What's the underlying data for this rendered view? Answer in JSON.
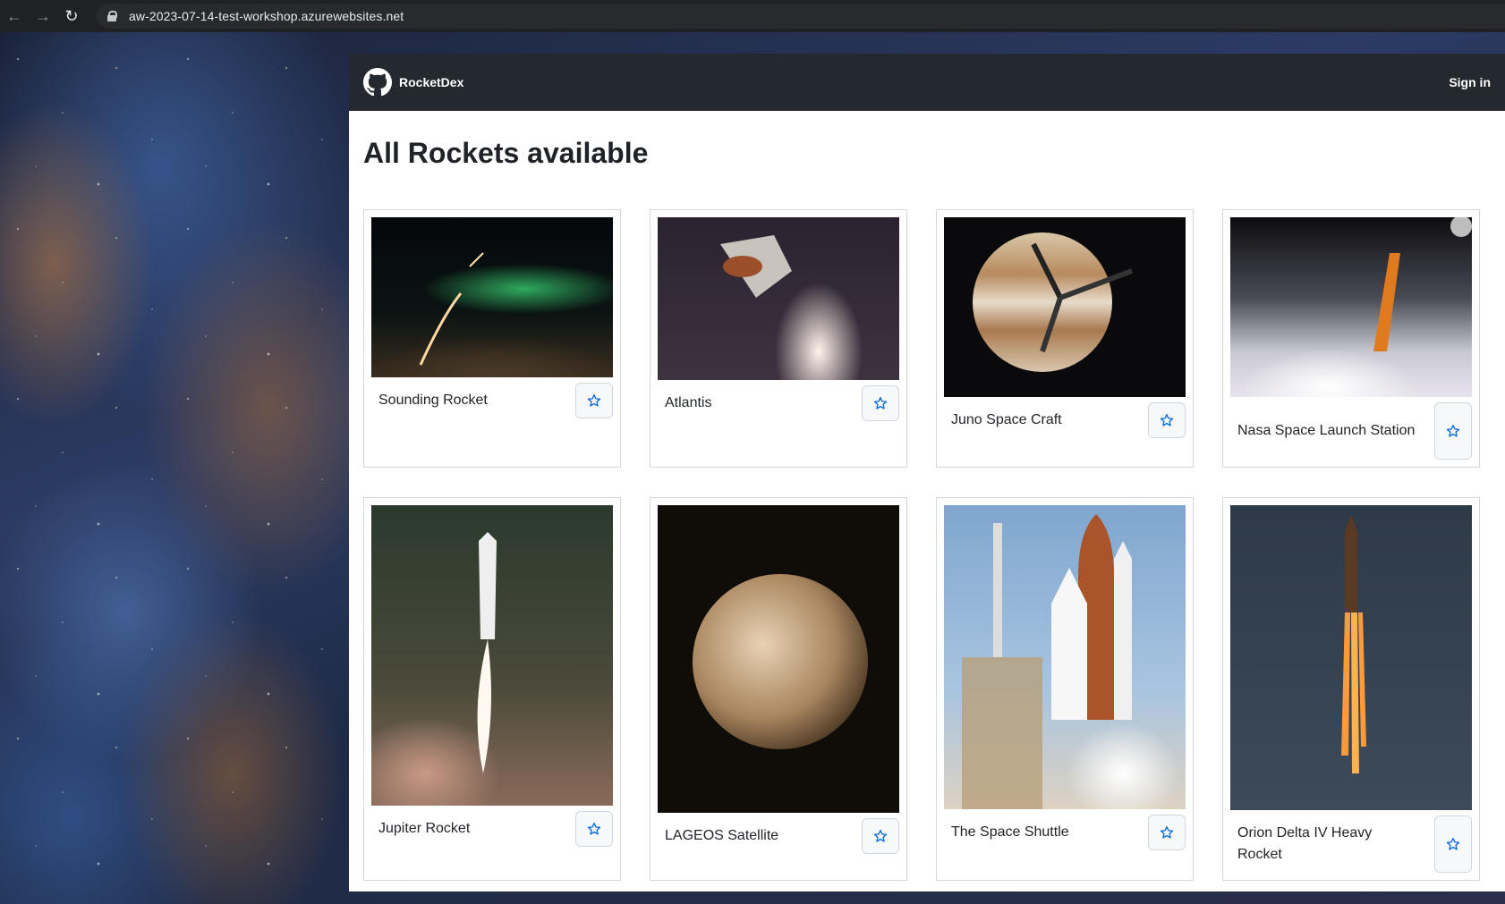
{
  "browser": {
    "url": "aw-2023-07-14-test-workshop.azurewebsites.net"
  },
  "header": {
    "brand": "RocketDex",
    "sign_in": "Sign in"
  },
  "page": {
    "title": "All Rockets available"
  },
  "rockets": [
    {
      "name": "Sounding Rocket"
    },
    {
      "name": "Atlantis"
    },
    {
      "name": "Juno Space Craft"
    },
    {
      "name": "Nasa Space Launch Station"
    },
    {
      "name": "Jupiter Rocket"
    },
    {
      "name": "LAGEOS Satellite"
    },
    {
      "name": "The Space Shuttle"
    },
    {
      "name": "Orion Delta IV Heavy Rocket"
    }
  ],
  "icons": {
    "back": "arrow-left-icon",
    "forward": "arrow-right-icon",
    "reload": "reload-icon",
    "lock": "lock-icon",
    "logo": "github-icon",
    "star": "star-outline-icon"
  },
  "colors": {
    "header_bg": "#24292f",
    "star_blue": "#0969da",
    "card_border": "#d0d7de"
  }
}
